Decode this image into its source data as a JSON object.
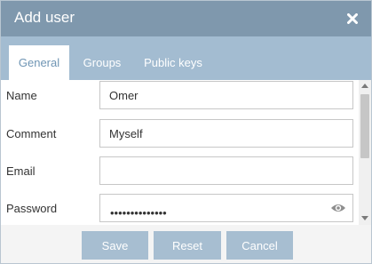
{
  "dialog": {
    "title": "Add user",
    "close_icon": "close-icon"
  },
  "tabs": [
    {
      "label": "General",
      "active": true
    },
    {
      "label": "Groups",
      "active": false
    },
    {
      "label": "Public keys",
      "active": false
    }
  ],
  "form": {
    "name": {
      "label": "Name",
      "value": "Omer"
    },
    "comment": {
      "label": "Comment",
      "value": "Myself"
    },
    "email": {
      "label": "Email",
      "value": ""
    },
    "password": {
      "label": "Password",
      "masked_value": "••••••••••••••",
      "reveal_icon": "eye-icon"
    }
  },
  "footer": {
    "save_label": "Save",
    "reset_label": "Reset",
    "cancel_label": "Cancel"
  },
  "colors": {
    "titlebar": "#7f98ad",
    "tabbar": "#a3bcd1",
    "active_tab_text": "#6f95b4",
    "button": "#a7bed1"
  }
}
